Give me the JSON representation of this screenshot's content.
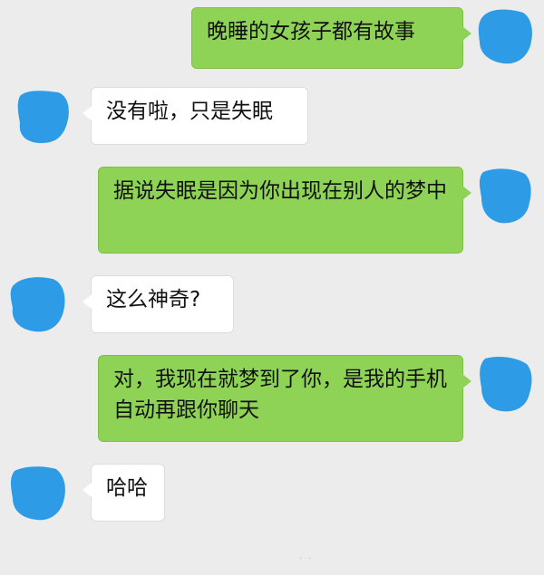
{
  "conversation": {
    "messages": [
      {
        "side": "out",
        "text": "晚睡的女孩子都有故事"
      },
      {
        "side": "in",
        "text": "没有啦，只是失眠"
      },
      {
        "side": "out",
        "text": "据说失眠是因为你出现在别人的梦中"
      },
      {
        "side": "in",
        "text": "这么神奇?"
      },
      {
        "side": "out",
        "text": "对，我现在就梦到了你，是我的手机自动再跟你聊天"
      },
      {
        "side": "in",
        "text": "哈哈"
      }
    ]
  },
  "colors": {
    "background": "#ececec",
    "outgoing_bubble": "#8ed356",
    "incoming_bubble": "#ffffff",
    "avatar_blur": "#2e9be6"
  },
  "icons": {
    "avatar": "avatar-redacted-icon"
  }
}
